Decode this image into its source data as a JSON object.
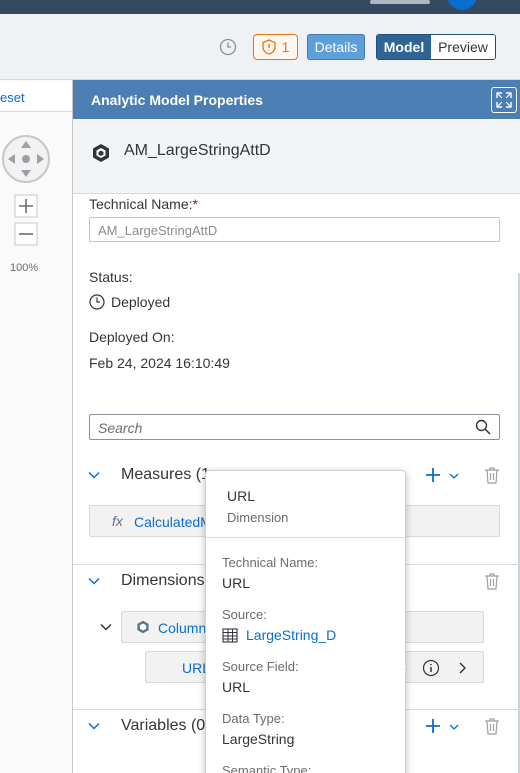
{
  "toolbar": {
    "badge_count": "1",
    "details_label": "Details",
    "model_label": "Model",
    "preview_label": "Preview"
  },
  "canvas": {
    "reset_label": "eset",
    "zoom_level": "100%"
  },
  "panel": {
    "title": "Analytic Model Properties",
    "model_name": "AM_LargeStringAttD",
    "technical_name_label": "Technical Name:",
    "required_mark": "*",
    "technical_name_value": "AM_LargeStringAttD",
    "status_label": "Status:",
    "status_value": "Deployed",
    "deployed_on_label": "Deployed On:",
    "deployed_on_value": "Feb 24, 2024 16:10:49",
    "search_placeholder": "Search",
    "measures_title": "Measures (1",
    "measure_item": "CalculatedM",
    "dimensions_title": "Dimensions",
    "dimension_item": "Column",
    "dimension_child": "URL",
    "variables_title": "Variables (0)"
  },
  "popover": {
    "title": "URL",
    "subtitle": "Dimension",
    "technical_name_label": "Technical Name:",
    "technical_name_value": "URL",
    "source_label": "Source:",
    "source_value": "LargeString_D",
    "source_field_label": "Source Field:",
    "source_field_value": "URL",
    "data_type_label": "Data Type:",
    "data_type_value": "LargeString",
    "semantic_type_label": "Semantic Type:"
  },
  "colors": {
    "accent": "#0a6ed1",
    "header": "#4b7fb3",
    "warning": "#e9730c"
  }
}
